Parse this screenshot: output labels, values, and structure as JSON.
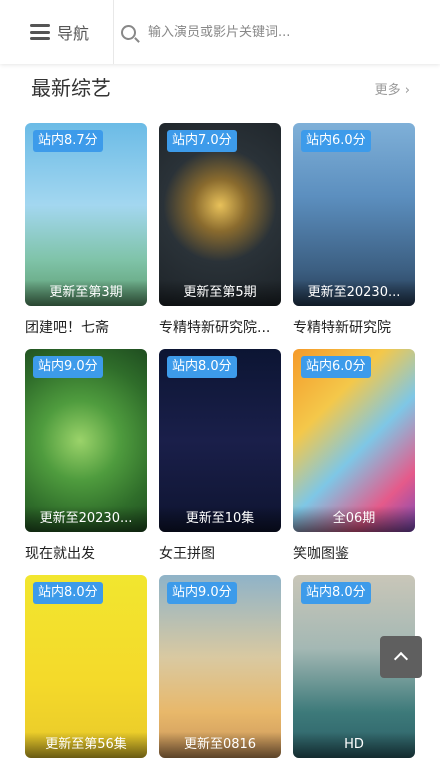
{
  "header": {
    "nav_label": "导航",
    "search_placeholder": "输入演员或影片关键词..."
  },
  "section": {
    "title": "最新综艺",
    "more_label": "更多"
  },
  "items": [
    {
      "title": "团建吧！七斋",
      "rating": "站内8.7分",
      "status": "更新至第3期"
    },
    {
      "title": "专精特新研究院...",
      "rating": "站内7.0分",
      "status": "更新至第5期"
    },
    {
      "title": "专精特新研究院",
      "rating": "站内6.0分",
      "status": "更新至20230..."
    },
    {
      "title": "现在就出发",
      "rating": "站内9.0分",
      "status": "更新至20230..."
    },
    {
      "title": "女王拼图",
      "rating": "站内8.0分",
      "status": "更新至10集"
    },
    {
      "title": "笑咖图鉴",
      "rating": "站内6.0分",
      "status": "全06期"
    },
    {
      "title": "",
      "rating": "站内8.0分",
      "status": "更新至第56集"
    },
    {
      "title": "",
      "rating": "站内9.0分",
      "status": "更新至0816"
    },
    {
      "title": "",
      "rating": "站内8.0分",
      "status": "HD"
    }
  ]
}
